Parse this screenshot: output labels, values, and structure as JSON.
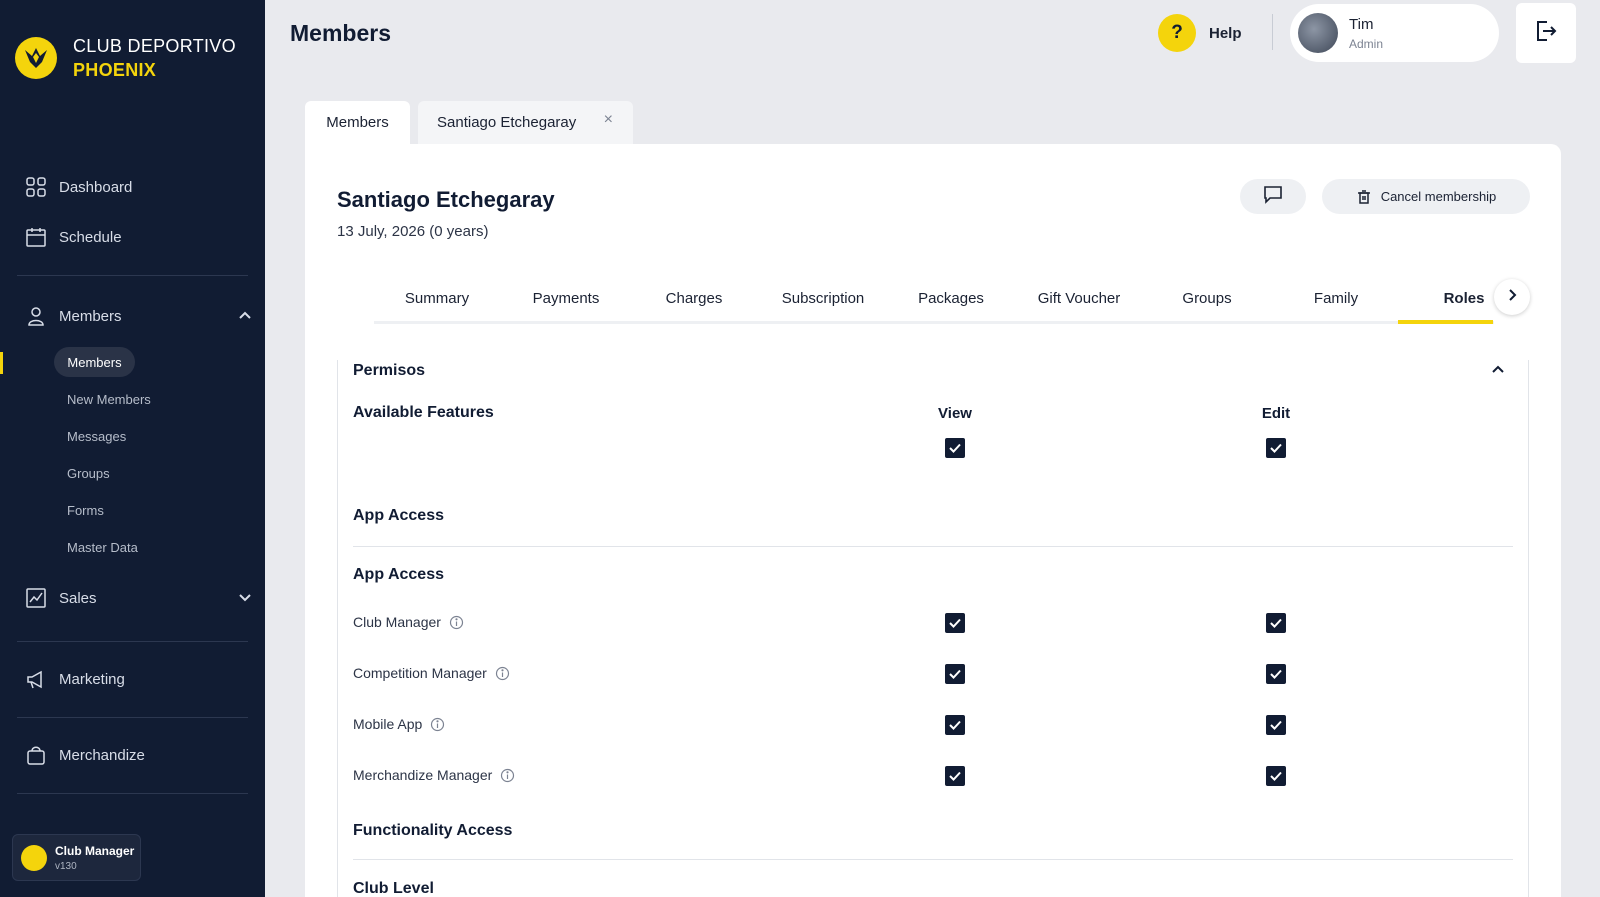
{
  "brand": {
    "line1": "CLUB DEPORTIVO",
    "line2": "PHOENIX",
    "accent": "#f4d40c",
    "sidebar_bg": "#111c33"
  },
  "sidebar": {
    "dashboard": "Dashboard",
    "schedule": "Schedule",
    "members": "Members",
    "members_sub": {
      "members": "Members",
      "new_members": "New Members",
      "messages": "Messages",
      "groups": "Groups",
      "forms": "Forms",
      "master_data": "Master Data"
    },
    "sales": "Sales",
    "marketing": "Marketing",
    "merchandize": "Merchandize",
    "version_card": {
      "title": "Club Manager",
      "version": "v130"
    }
  },
  "header": {
    "title": "Members",
    "help_symbol": "?",
    "help_label": "Help",
    "user": {
      "name": "Tim",
      "role": "Admin"
    }
  },
  "top_tabs": {
    "members": "Members",
    "person": "Santiago  Etchegaray",
    "close_symbol": "×"
  },
  "person": {
    "name": "Santiago  Etchegaray",
    "date": "13 July, 2026 (0 years)",
    "cancel_label": "Cancel membership"
  },
  "sub_tabs": {
    "summary": "Summary",
    "payments": "Payments",
    "charges": "Charges",
    "subscription": "Subscription",
    "packages": "Packages",
    "gift_voucher": "Gift Voucher",
    "groups": "Groups",
    "family": "Family",
    "roles": "Roles",
    "active": "Roles"
  },
  "permissions": {
    "title": "Permisos",
    "features_header": "Available Features",
    "view_header": "View",
    "edit_header": "Edit",
    "app_access_1": "App Access",
    "app_access_2": "App Access",
    "rows": [
      {
        "label": "Club Manager",
        "view": true,
        "edit": true
      },
      {
        "label": "Competition Manager",
        "view": true,
        "edit": true
      },
      {
        "label": "Mobile App",
        "view": true,
        "edit": true
      },
      {
        "label": "Merchandize Manager",
        "view": true,
        "edit": true
      }
    ],
    "functionality_access": "Functionality Access",
    "club_level": "Club Level"
  }
}
